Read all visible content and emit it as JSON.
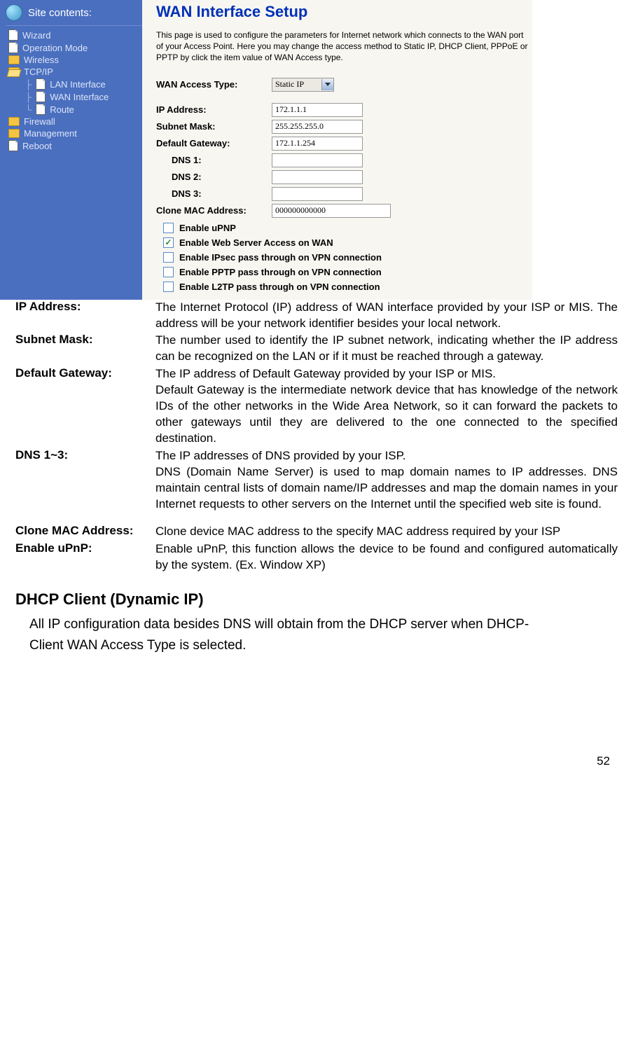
{
  "sidebar": {
    "title": "Site contents:",
    "items": [
      {
        "label": "Wizard",
        "type": "doc",
        "level": 0
      },
      {
        "label": "Operation Mode",
        "type": "doc",
        "level": 0
      },
      {
        "label": "Wireless",
        "type": "folder",
        "level": 0
      },
      {
        "label": "TCP/IP",
        "type": "open-folder",
        "level": 0
      },
      {
        "label": "LAN Interface",
        "type": "doc",
        "level": 1
      },
      {
        "label": "WAN Interface",
        "type": "doc",
        "level": 1
      },
      {
        "label": "Route",
        "type": "doc",
        "level": 1
      },
      {
        "label": "Firewall",
        "type": "folder",
        "level": 0
      },
      {
        "label": "Management",
        "type": "folder",
        "level": 0
      },
      {
        "label": "Reboot",
        "type": "doc",
        "level": 0
      }
    ]
  },
  "content": {
    "title": "WAN Interface Setup",
    "intro": "This page is used to configure the parameters for Internet network which connects to the WAN port of your Access Point. Here you may change the access method to Static IP, DHCP Client, PPPoE or PPTP by click the item value of WAN Access type.",
    "fields": {
      "access_type_label": "WAN Access Type:",
      "access_type_value": "Static IP",
      "ip_label": "IP Address:",
      "ip_value": "172.1.1.1",
      "mask_label": "Subnet Mask:",
      "mask_value": "255.255.255.0",
      "gw_label": "Default Gateway:",
      "gw_value": "172.1.1.254",
      "dns1_label": "DNS 1:",
      "dns1_value": "",
      "dns2_label": "DNS 2:",
      "dns2_value": "",
      "dns3_label": "DNS 3:",
      "dns3_value": "",
      "mac_label": "Clone MAC Address:",
      "mac_value": "000000000000"
    },
    "checks": [
      {
        "label": "Enable uPNP",
        "checked": false
      },
      {
        "label": "Enable Web Server Access on WAN",
        "checked": true
      },
      {
        "label": "Enable IPsec pass through on VPN connection",
        "checked": false
      },
      {
        "label": "Enable PPTP pass through on VPN connection",
        "checked": false
      },
      {
        "label": "Enable L2TP pass through on VPN connection",
        "checked": false
      }
    ]
  },
  "defs": [
    {
      "term": "IP Address:",
      "desc": "The Internet Protocol (IP) address of WAN interface provided by your ISP or MIS. The address will be your network  identifier besides your local network."
    },
    {
      "term": "Subnet Mask:",
      "desc": "The number used to identify the IP subnet network, indicating whether the IP address can be recognized on the LAN or if it must be reached through a gateway."
    },
    {
      "term": "Default Gateway:",
      "desc": "The IP address of Default Gateway provided by your ISP or MIS.\nDefault Gateway is the intermediate network device that has knowledge of the network IDs of the other networks in the Wide Area Network, so it can forward the packets to other gateways until they are delivered to the one connected to the specified destination."
    },
    {
      "term": "DNS 1~3:",
      "desc": "The IP addresses of DNS provided by your ISP.\nDNS (Domain Name Server) is used to map domain names to IP addresses. DNS maintain central lists of domain name/IP addresses and map the domain names in your Internet requests to other servers on the Internet until the specified web site is found."
    },
    {
      "term": "Clone MAC Address:",
      "desc": "Clone device MAC address to the specify MAC address required by your ISP"
    },
    {
      "term": "Enable uPnP:",
      "desc": "Enable uPnP, this function allows the device to be found and configured automatically by the system. (Ex. Window XP)"
    }
  ],
  "dhcp": {
    "heading": "DHCP Client (Dynamic IP)",
    "paragraph": "All IP configuration data besides DNS will obtain from the DHCP server when DHCP-Client WAN Access Type is selected."
  },
  "page_number": "52"
}
